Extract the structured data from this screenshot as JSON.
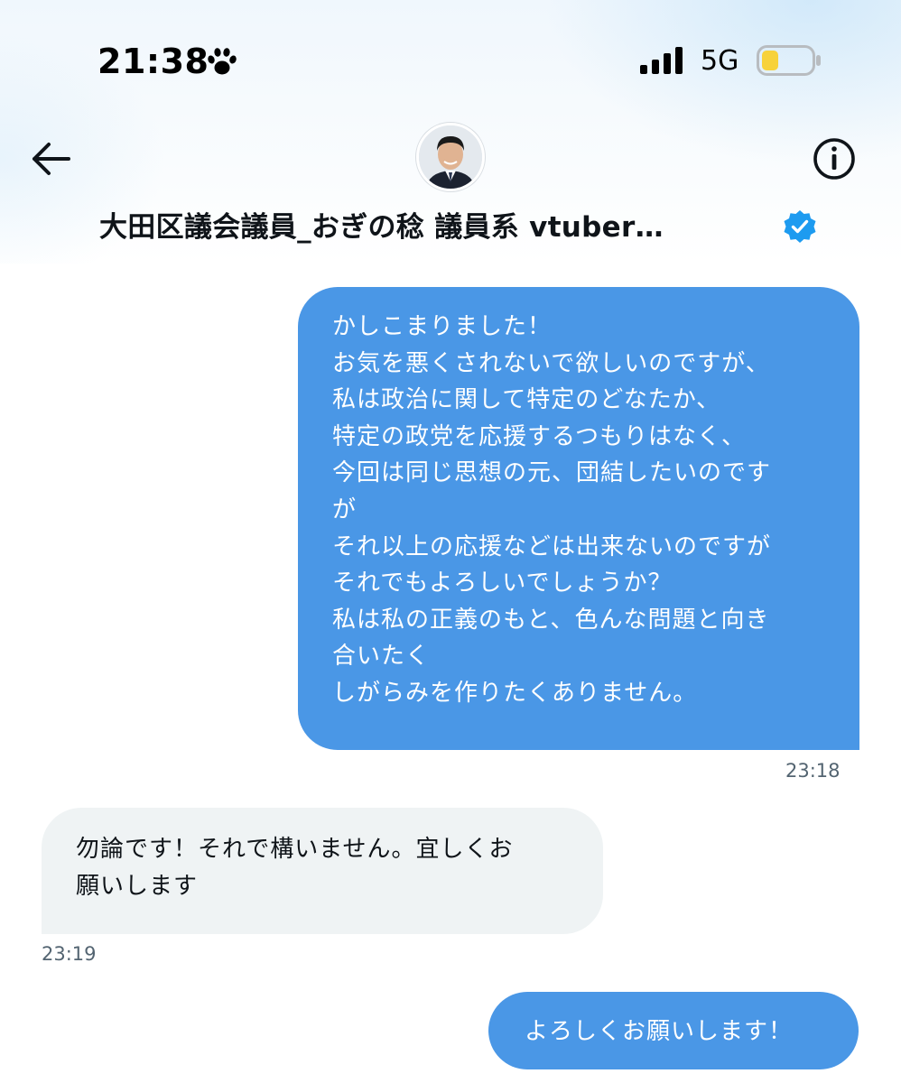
{
  "status_bar": {
    "time": "21:38",
    "time_icon": "paw-icon",
    "network": "5G",
    "signal_icon": "signal-bars-icon",
    "battery_icon": "battery-low-icon",
    "battery_color": "#f7d23a"
  },
  "header": {
    "back_icon": "back-arrow-icon",
    "info_icon": "info-icon",
    "avatar_icon": "profile-avatar",
    "contact_name": "大田区議会議員_おぎの稔 議員系 vtuber…",
    "verified_icon": "verified-badge-icon",
    "verified_color": "#1d9bf0"
  },
  "messages": [
    {
      "direction": "outgoing",
      "lines": [
        "かしこまりました！",
        "お気を悪くされないで欲しいのですが、",
        "私は政治に関して特定のどなたか、",
        "特定の政党を応援するつもりはなく、",
        "今回は同じ思想の元、団結したいのです",
        "が",
        "それ以上の応援などは出来ないのですが",
        "それでもよろしいでしょうか？",
        "私は私の正義のもと、色んな問題と向き",
        "合いたく",
        "しがらみを作りたくありません。"
      ],
      "time": "23:18"
    },
    {
      "direction": "incoming",
      "lines": [
        "勿論です！それで構いません。宜しくお",
        "願いします"
      ],
      "time": "23:19"
    },
    {
      "direction": "outgoing",
      "lines": [
        "よろしくお願いします！"
      ]
    }
  ],
  "colors": {
    "outgoing_bubble": "#4a97e6",
    "incoming_bubble": "#eff3f4",
    "timestamp": "#536471"
  }
}
